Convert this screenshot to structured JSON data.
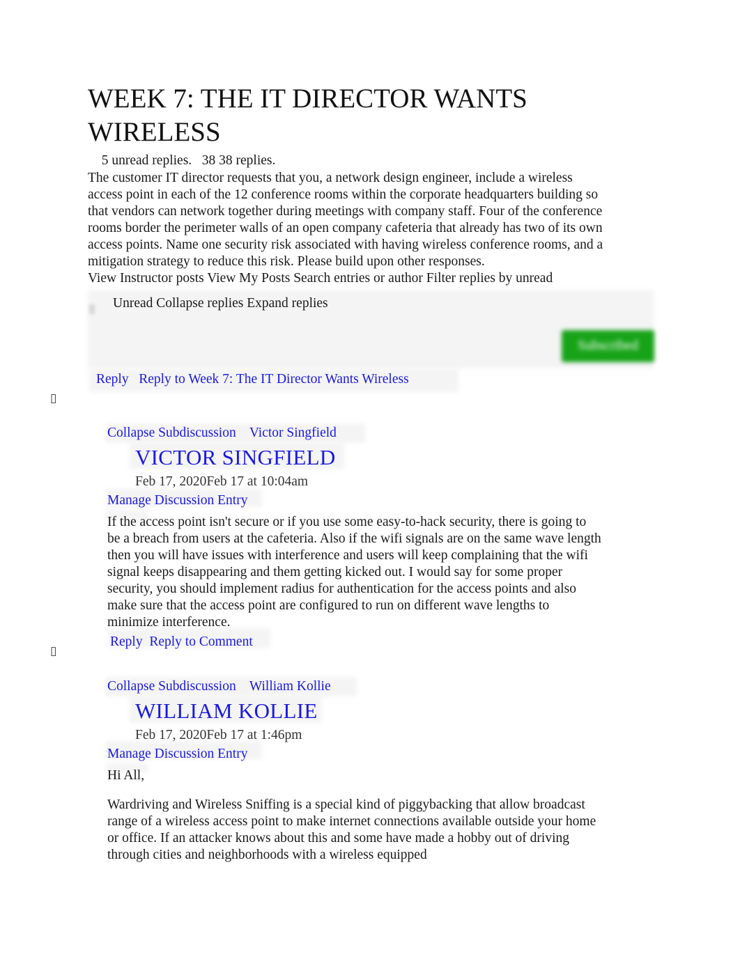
{
  "page": {
    "title": "WEEK 7: THE IT DIRECTOR WANTS WIRELESS",
    "reply_counts": "  5 unread replies.   38 38 replies.",
    "prompt": "The customer IT director requests that you, a network design engineer, include a wireless access point in each of the 12 conference rooms within the corporate headquarters building so that vendors can network together during meetings with company staff. Four of the conference rooms border the perimeter walls of an open company cafeteria that already has two of its own access points. Name one security risk associated with having wireless conference rooms, and a mitigation strategy to reduce this risk. Please build upon other responses."
  },
  "toolbar": {
    "filters_line": "View Instructor posts View My Posts Search entries or author Filter replies by unread",
    "row2": "Unread Collapse replies Expand replies",
    "subscribed_label": "Subscribed",
    "subscribed_color": "#17a318"
  },
  "top_reply": {
    "reply_label": "Reply",
    "reply_to_label": "Reply to Week 7: The IT Director Wants Wireless"
  },
  "markers": {
    "tofu": "▯"
  },
  "link_color": "#1b19e0",
  "entries": [
    {
      "collapse_label": "Collapse Subdiscussion",
      "author_link": "Victor Singfield",
      "author_display": "VICTOR SINGFIELD",
      "date": "Feb 17, 2020Feb 17 at 10:04am",
      "manage_label": "Manage Discussion Entry",
      "body": "If the access point isn't secure or if you use some easy-to-hack security, there is going to be a breach from users at the cafeteria. Also if the wifi signals are on the same wave length then you will have issues with interference and users will keep complaining that the wifi signal keeps disappearing and them getting kicked out. I would say for some proper security, you should implement radius for authentication for the access points and also make sure that the access point are configured to run on different wave lengths to minimize interference.",
      "reply_label": "Reply",
      "reply_to_label": "Reply to Comment"
    },
    {
      "collapse_label": "Collapse Subdiscussion",
      "author_link": "William Kollie",
      "author_display": "WILLIAM KOLLIE",
      "date": "Feb 17, 2020Feb 17 at 1:46pm",
      "manage_label": "Manage Discussion Entry",
      "body_p1": "Hi All,",
      "body_p2": "Wardriving and Wireless Sniffing is a special kind of piggybacking that allow broadcast range of a wireless access point to make internet connections available outside your home or office. If an attacker knows about this and some have made a hobby out of driving through cities and neighborhoods with a wireless equipped"
    }
  ]
}
